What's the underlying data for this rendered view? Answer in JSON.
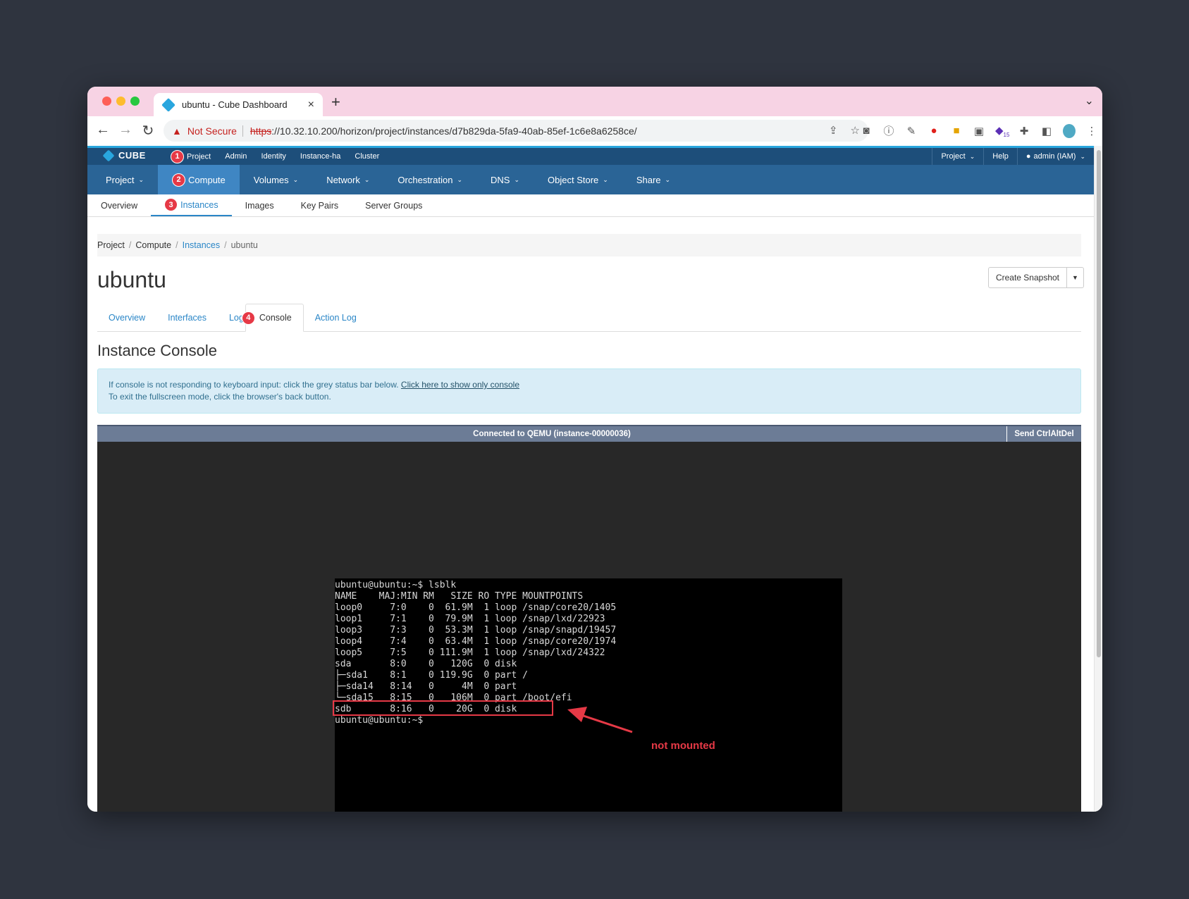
{
  "browser": {
    "tab_title": "ubuntu - Cube Dashboard",
    "security_label": "Not Secure",
    "url_scheme": "https",
    "url_rest": "://10.32.10.200/horizon/project/instances/d7b829da-5fa9-40ab-85ef-1c6e8a6258ce/",
    "extension_badge": "15"
  },
  "topnav": {
    "logo": "CUBE",
    "items": [
      "Project",
      "Admin",
      "Identity",
      "Instance-ha",
      "Cluster"
    ],
    "right": {
      "project": "Project",
      "help": "Help",
      "user": "admin (IAM)"
    }
  },
  "mainnav": {
    "items": [
      "Project",
      "Compute",
      "Volumes",
      "Network",
      "Orchestration",
      "DNS",
      "Object Store",
      "Share"
    ]
  },
  "subnav": {
    "items": [
      "Overview",
      "Instances",
      "Images",
      "Key Pairs",
      "Server Groups"
    ]
  },
  "breadcrumb": {
    "project": "Project",
    "compute": "Compute",
    "instances": "Instances",
    "current": "ubuntu"
  },
  "page": {
    "title": "ubuntu",
    "snapshot_button": "Create Snapshot",
    "tabs": [
      "Overview",
      "Interfaces",
      "Log",
      "Console",
      "Action Log"
    ],
    "console_title": "Instance Console",
    "alert_line1": "If console is not responding to keyboard input: click the grey status bar below.",
    "alert_link": "Click here to show only console",
    "alert_line2": "To exit the fullscreen mode, click the browser's back button."
  },
  "console": {
    "status": "Connected to QEMU (instance-00000036)",
    "ctrl_alt_del": "Send CtrlAltDel",
    "terminal_text": "ubuntu@ubuntu:~$ lsblk\nNAME    MAJ:MIN RM   SIZE RO TYPE MOUNTPOINTS\nloop0     7:0    0  61.9M  1 loop /snap/core20/1405\nloop1     7:1    0  79.9M  1 loop /snap/lxd/22923\nloop3     7:3    0  53.3M  1 loop /snap/snapd/19457\nloop4     7:4    0  63.4M  1 loop /snap/core20/1974\nloop5     7:5    0 111.9M  1 loop /snap/lxd/24322\nsda       8:0    0   120G  0 disk\n├─sda1    8:1    0 119.9G  0 part /\n├─sda14   8:14   0     4M  0 part\n└─sda15   8:15   0   106M  0 part /boot/efi\nsdb       8:16   0    20G  0 disk\nubuntu@ubuntu:~$",
    "annotation": "not mounted"
  },
  "badges": [
    "1",
    "2",
    "3",
    "4"
  ],
  "colors": {
    "nav_dark": "#1d4e7a",
    "nav_main": "#2a6496",
    "nav_active": "#3f86c3",
    "link": "#2a86c7",
    "annotation_red": "#e63946"
  }
}
